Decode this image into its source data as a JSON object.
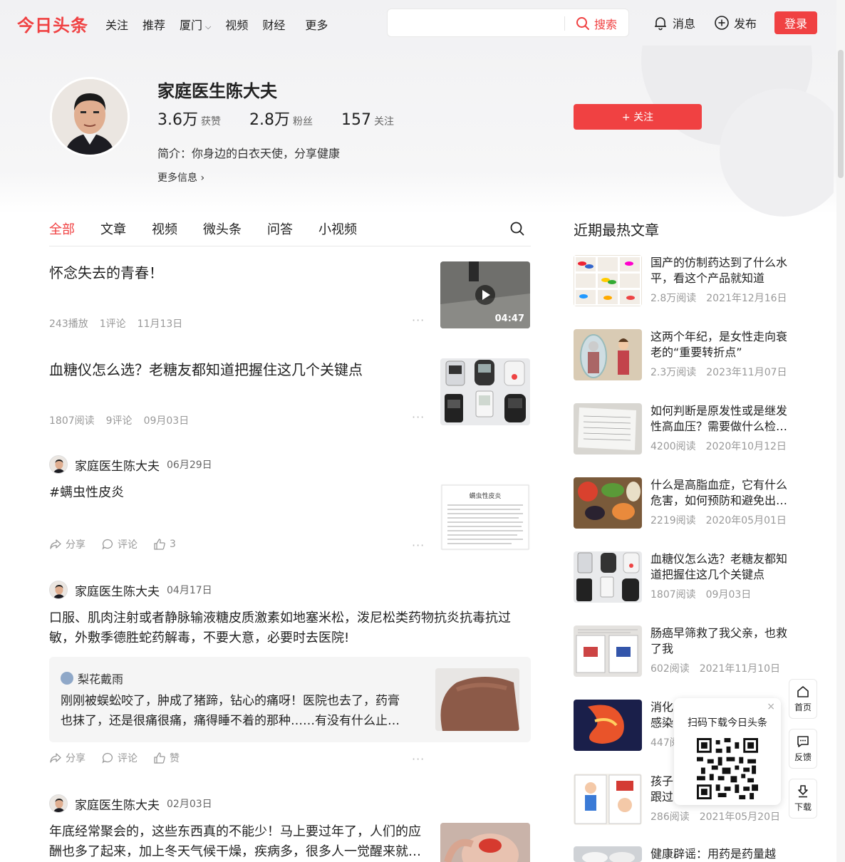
{
  "header": {
    "logo": "今日头条",
    "nav": [
      "关注",
      "推荐",
      "厦门",
      "视频",
      "财经",
      "更多"
    ],
    "search_placeholder": "",
    "search_label": "搜索",
    "messages_label": "消息",
    "publish_label": "发布",
    "login_label": "登录"
  },
  "profile": {
    "name": "家庭医生陈大夫",
    "likes_num": "3.6万",
    "likes_label": "获赞",
    "fans_num": "2.8万",
    "fans_label": "粉丝",
    "following_num": "157",
    "following_label": "关注",
    "bio": "简介：你身边的白衣天使，分享健康",
    "more_info": "更多信息 ›",
    "follow_label": "+ 关注"
  },
  "tabs": [
    "全部",
    "文章",
    "视频",
    "微头条",
    "问答",
    "小视频"
  ],
  "feed": {
    "item1": {
      "title": "怀念失去的青春！",
      "plays": "243播放",
      "comments": "1评论",
      "date": "11月13日",
      "duration": "04:47"
    },
    "item2": {
      "title": "血糖仪怎么选？老糖友都知道把握住这几个关键点",
      "reads": "1807阅读",
      "comments": "9评论",
      "date": "09月03日"
    },
    "item3": {
      "author": "家庭医生陈大夫",
      "date": "06月29日",
      "text": "#螨虫性皮炎",
      "share": "分享",
      "comment": "评论",
      "likes": "3",
      "doc_heading": "螨虫性皮炎"
    },
    "item4": {
      "author": "家庭医生陈大夫",
      "date": "04月17日",
      "text_line1": "口服、肌肉注射或者静脉输液糖皮质激素如地塞米松，泼尼松类药物抗炎抗毒抗过",
      "text_line2": "敏，外敷季德胜蛇药解毒，不要大意，必要时去医院!",
      "quote_user": "梨花戴雨",
      "quote_line1": "刚刚被蜈蚣咬了，肿成了猪蹄，钻心的痛呀！医院也去了，药膏",
      "quote_line2": "也抹了，还是很痛很痛，痛得睡不着的那种……有没有什么止…",
      "share": "分享",
      "comment": "评论",
      "like": "赞"
    },
    "item5": {
      "author": "家庭医生陈大夫",
      "date": "02月03日",
      "text_line1": "年底经常聚会的，这些东西真的不能少！马上要过年了，人们的应",
      "text_line2": "酬也多了起来，加上冬天气候干燥，疾病多，很多人一觉醒来就…"
    },
    "more_dots": "···"
  },
  "sidebar": {
    "title": "近期最热文章",
    "items": [
      {
        "title": "国产的仿制药达到了什么水平，看这个产品就知道",
        "reads": "2.8万阅读",
        "date": "2021年12月16日"
      },
      {
        "title": "这两个年纪，是女性走向衰老的“重要转折点”",
        "reads": "2.3万阅读",
        "date": "2023年11月07日"
      },
      {
        "title": "如何判断是原发性或是继发性高血压？需要做什么检…",
        "reads": "4200阅读",
        "date": "2020年10月12日"
      },
      {
        "title": "什么是高脂血症，它有什么危害，如何预防和避免出…",
        "reads": "2219阅读",
        "date": "2020年05月01日"
      },
      {
        "title": "血糖仪怎么选？老糖友都知道把握住这几个关键点",
        "reads": "1807阅读",
        "date": "09月03日"
      },
      {
        "title": "肠癌早筛救了我父亲，也救了我",
        "reads": "602阅读",
        "date": "2021年11月10日"
      },
      {
        "title": "消化",
        "line2": "感染",
        "reads": "447阅",
        "date": ""
      },
      {
        "title": "孩子",
        "line2": "跟过",
        "reads": "286阅读",
        "date": "2021年05月20日"
      },
      {
        "title": "健康辟谣：用药是药量越",
        "reads": "",
        "date": ""
      }
    ]
  },
  "qr": {
    "title": "扫码下载今日头条",
    "close": "×"
  },
  "floating": {
    "home": "首页",
    "feedback": "反馈",
    "download": "下载"
  },
  "colors": {
    "accent": "#f04142"
  }
}
